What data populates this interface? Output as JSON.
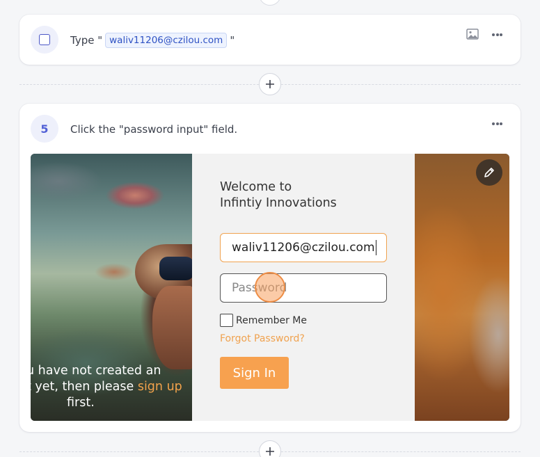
{
  "step4": {
    "text_prefix": "Type \"",
    "typed_value": "waliv11206@czilou.com",
    "text_suffix": "\""
  },
  "step5": {
    "number": "5",
    "text": "Click the \"password input\" field."
  },
  "screenshot": {
    "welcome_line1": "Welcome to",
    "welcome_line2": "Infintiy Innovations",
    "email_value": "waliv11206@czilou.com",
    "password_placeholder": "Password",
    "remember_label": "Remember Me",
    "forgot_label": "Forgot Password?",
    "signin_label": "Sign In",
    "signup_line1": "u have not created an",
    "signup_line2_prefix": "t yet, then please ",
    "signup_link": "sign up",
    "signup_line3": "first."
  },
  "icons": {
    "step4_badge": "checkbox-icon",
    "image": "image-icon",
    "more": "more-options-icon",
    "add": "plus-icon",
    "edit": "pencil-icon"
  },
  "colors": {
    "accent": "#5160d6",
    "orange": "#f7a14f",
    "chip_text": "#2f52c4"
  }
}
